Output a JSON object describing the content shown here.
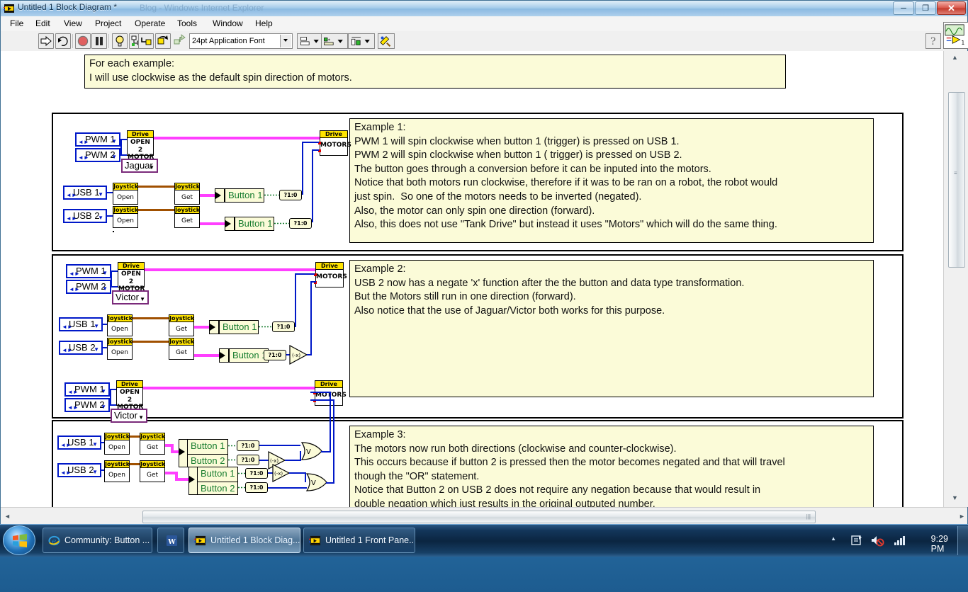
{
  "window": {
    "title": "Untitled 1 Block Diagram *",
    "ghost_title": "Blog - Windows Internet Explorer",
    "minimize": "–",
    "maximize": "❐",
    "close": "✕",
    "icon": "labview-vi-icon"
  },
  "menu": [
    {
      "label": "File"
    },
    {
      "label": "Edit"
    },
    {
      "label": "View"
    },
    {
      "label": "Project"
    },
    {
      "label": "Operate"
    },
    {
      "label": "Tools"
    },
    {
      "label": "Window"
    },
    {
      "label": "Help"
    }
  ],
  "toolbar": {
    "run": "run-arrow-icon",
    "run_continuous": "run-continuously-icon",
    "abort": "abort-execution-icon",
    "pause": "pause-icon",
    "highlight": "highlight-execution-bulb-icon",
    "retain_wire": "retain-wire-values-icon",
    "step_into": "step-into-icon",
    "step_over": "step-over-icon",
    "step_out": "step-out-icon",
    "font_value": "24pt Application Font",
    "align_objects": "align-objects-icon",
    "distribute_objects": "distribute-objects-icon",
    "resize_objects": "resize-objects-icon",
    "reorder": "reorder-clean-up-icon",
    "help": "?"
  },
  "header_note": "For each example:\nI will use clockwise as the default spin direction of motors.",
  "examples": [
    {
      "id": "example-1",
      "note": "Example 1:\nPWM 1 will spin clockwise when button 1 (trigger) is pressed on USB 1.\nPWM 2 will spin clockwise when button 1 ( trigger) is pressed on USB 2.\nThe button goes through a conversion before it can be inputed into the motors.\nNotice that both motors run clockwise, therefore if it was to be ran on a robot, the robot would\njust spin.  So one of the motors needs to be inverted (negated).\nAlso, the motor can only spin one direction (forward).\nAlso, this does not use \"Tank Drive\" but instead it uses \"Motors\" which will do the same thing.",
      "controls": [
        "PWM 1",
        "PWM 2",
        "USB 1",
        "USB 2"
      ],
      "motor_type": "Jaguar",
      "open_vi": {
        "cap": "Drive",
        "line1": "OPEN",
        "line2": "2 MOTOR"
      },
      "motors_vi": {
        "cap": "Drive",
        "body": "MOTORS"
      },
      "joystick_open": {
        "cap": "Joystick",
        "body": "Open"
      },
      "joystick_get": {
        "cap": "Joystick",
        "body": "Get"
      },
      "buttons": [
        "Button 1",
        "Button 1"
      ],
      "convert": "?1:0",
      "negates": 0,
      "ors": 0
    },
    {
      "id": "example-2",
      "note": "Example 2:\nUSB 2 now has a negate 'x' function after the the button and data type transformation.\nBut the Motors still run in one direction (forward).\nAlso notice that the use of Jaguar/Victor both works for this purpose.",
      "controls": [
        "PWM 1",
        "PWM 2",
        "USB 1",
        "USB 2"
      ],
      "motor_type": "Victor",
      "open_vi": {
        "cap": "Drive",
        "line1": "OPEN",
        "line2": "2 MOTOR"
      },
      "motors_vi": {
        "cap": "Drive",
        "body": "MOTORS"
      },
      "joystick_open": {
        "cap": "Joystick",
        "body": "Open"
      },
      "joystick_get": {
        "cap": "Joystick",
        "body": "Get"
      },
      "buttons": [
        "Button 1",
        "Button 1"
      ],
      "convert": "?1:0",
      "negate_label": "(-x)",
      "negates": 1,
      "ors": 0
    },
    {
      "id": "example-3",
      "note": "Example 3:\nThe motors now run both directions (clockwise and counter-clockwise).\nThis occurs because if button 2 is pressed then the motor becomes negated and that will travel\nthough the \"OR\" statement.\nNotice that Button 2 on USB 2 does not require any negation because that would result in\ndouble negation which just results in the original outputed number.",
      "controls": [
        "PWM 1",
        "PWM 2",
        "USB 1",
        "USB 2"
      ],
      "motor_type": "Victor",
      "open_vi": {
        "cap": "Drive",
        "line1": "OPEN",
        "line2": "2 MOTOR"
      },
      "motors_vi": {
        "cap": "Drive",
        "body": "MOTORS"
      },
      "joystick_open": {
        "cap": "Joystick",
        "body": "Open"
      },
      "joystick_get": {
        "cap": "Joystick",
        "body": "Get"
      },
      "buttons_usb1": [
        "Button 1",
        "Button 2"
      ],
      "buttons_usb2": [
        "Button 1",
        "Button 2"
      ],
      "convert": "?1:0",
      "negate_label": "(-x)",
      "or_label": "V",
      "negates": 2,
      "ors": 2
    }
  ],
  "taskbar": {
    "start": "windows-start-orb",
    "items": [
      {
        "label": "Community: Button ...",
        "icon": "internet-explorer-icon",
        "active": false
      },
      {
        "label": "",
        "icon": "word-icon",
        "active": false
      },
      {
        "label": "Untitled 1 Block Diag...",
        "icon": "labview-vi-icon",
        "active": true
      },
      {
        "label": "Untitled 1 Front Pane...",
        "icon": "labview-vi-icon",
        "active": false
      }
    ],
    "tray": {
      "show_hidden": "▲",
      "action_center": "action-center-icon",
      "volume": "volume-muted-icon",
      "network": "network-signal-icon"
    },
    "clock": "9:29 PM"
  },
  "colors": {
    "note_bg": "#fbfbd8",
    "wire_blue": "#0018c8",
    "wire_pink": "#ff3fff",
    "wire_brown": "#a05000",
    "vi_caption": "#ffe400",
    "button_text": "#167c2e",
    "enum_border": "#7a2a7a"
  }
}
